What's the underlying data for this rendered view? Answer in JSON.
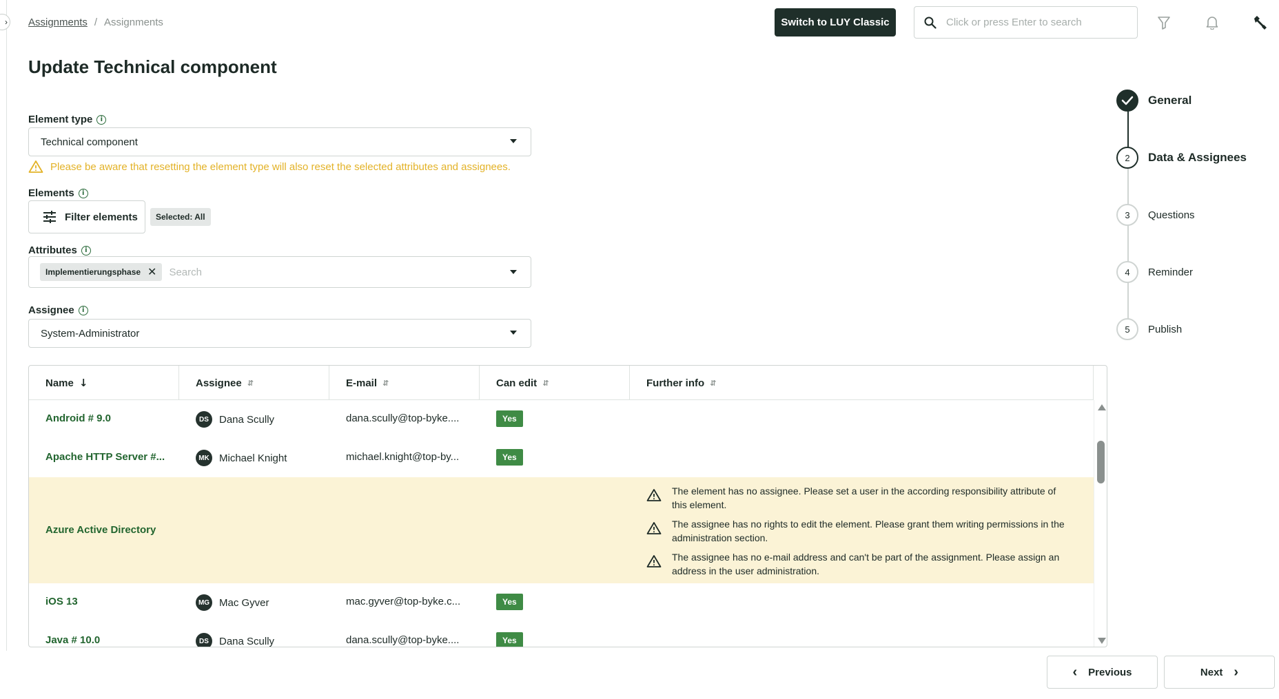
{
  "breadcrumb": {
    "root": "Assignments",
    "separator": "/",
    "current": "Assignments"
  },
  "header": {
    "switch_label": "Switch to LUY Classic",
    "search_placeholder": "Click or press Enter to search",
    "icons": [
      "search-icon",
      "filter-icon",
      "bell-icon",
      "wrench-icon"
    ]
  },
  "page": {
    "title": "Update Technical component"
  },
  "form": {
    "element_type": {
      "label": "Element type",
      "value": "Technical component"
    },
    "warning": "Please be aware that resetting the element type will also reset the selected attributes and assignees.",
    "elements": {
      "label": "Elements",
      "filter_label": "Filter elements",
      "selected_badge": "Selected: All"
    },
    "attributes": {
      "label": "Attributes",
      "chip": "Implementierungsphase",
      "placeholder": "Search"
    },
    "assignee": {
      "label": "Assignee",
      "value": "System-Administrator"
    }
  },
  "table": {
    "columns": [
      "Name",
      "Assignee",
      "E-mail",
      "Can edit",
      "Further info"
    ],
    "rows": [
      {
        "name": "Android # 9.0",
        "initials": "DS",
        "assignee": "Dana Scully",
        "email": "dana.scully@top-byke....",
        "can_edit": "Yes"
      },
      {
        "name": "Apache HTTP Server #...",
        "initials": "MK",
        "assignee": "Michael Knight",
        "email": "michael.knight@top-by...",
        "can_edit": "Yes"
      },
      {
        "name": "Azure Active Directory",
        "messages": [
          "The element has no assignee. Please set a user in the according responsibility attribute of this element.",
          "The assignee has no rights to edit the element. Please grant them writing permissions in the administration section.",
          "The assignee has no e-mail address and can't be part of the assignment. Please assign an address in the user administration."
        ]
      },
      {
        "name": "iOS 13",
        "initials": "MG",
        "assignee": "Mac Gyver",
        "email": "mac.gyver@top-byke.c...",
        "can_edit": "Yes"
      },
      {
        "name": "Java # 10.0",
        "initials": "DS",
        "assignee": "Dana Scully",
        "email": "dana.scully@top-byke....",
        "can_edit": "Yes"
      }
    ]
  },
  "steps": [
    {
      "number": "",
      "label": "General",
      "state": "done"
    },
    {
      "number": "2",
      "label": "Data & Assignees",
      "state": "active"
    },
    {
      "number": "3",
      "label": "Questions",
      "state": "todo"
    },
    {
      "number": "4",
      "label": "Reminder",
      "state": "todo"
    },
    {
      "number": "5",
      "label": "Publish",
      "state": "todo"
    }
  ],
  "footer": {
    "previous": "Previous",
    "next": "Next"
  },
  "colors": {
    "primary": "#1f2f2a",
    "link_green": "#22652f",
    "yes_green": "#3f8b45",
    "warning_yellow": "#e3b227",
    "warn_row_bg": "#fbf3d6"
  }
}
